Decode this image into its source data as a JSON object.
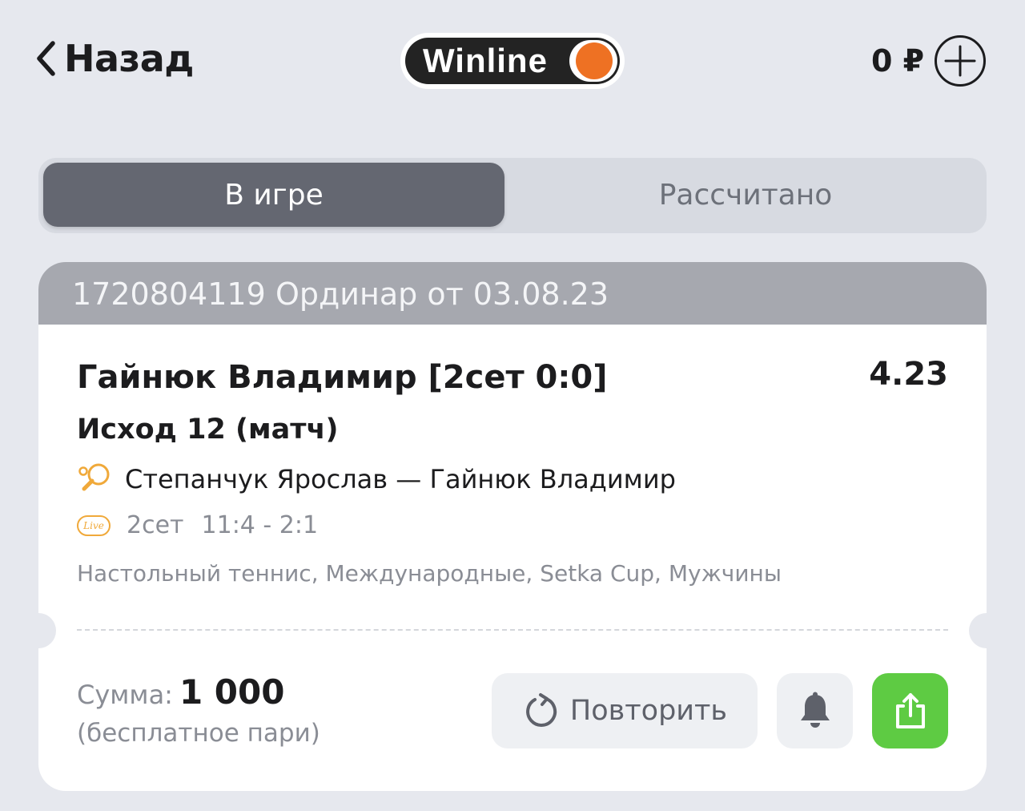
{
  "header": {
    "back_label": "Назад",
    "logo_text": "Winline",
    "balance": "0 ₽"
  },
  "tabs": [
    {
      "label": "В игре",
      "active": true
    },
    {
      "label": "Рассчитано",
      "active": false
    }
  ],
  "bet": {
    "id": "1720804119",
    "type_date": "Ординар от 03.08.23",
    "selection": "Гайнюк Владимир [2сет 0:0]",
    "odds": "4.23",
    "market": "Исход 12 (матч)",
    "event": "Степанчук Ярослав — Гайнюк Владимир",
    "live_badge": "Live",
    "set": "2сет",
    "score": "11:4 - 2:1",
    "tournament": "Настольный теннис, Международные, Setka Cup, Мужчины",
    "sum_label": "Сумма:",
    "sum_amount": "1 000",
    "free_note": "(бесплатное пари)",
    "repeat_label": "Повторить"
  },
  "colors": {
    "background": "#e6e8ee",
    "accent_orange": "#ee7123",
    "share_green": "#5ecb43",
    "tab_active": "#646771",
    "card_header": "#a6a8af"
  },
  "icons": [
    "chevron-left-icon",
    "plus-circle-icon",
    "table-tennis-icon",
    "live-icon",
    "refresh-icon",
    "bell-icon",
    "share-icon"
  ]
}
